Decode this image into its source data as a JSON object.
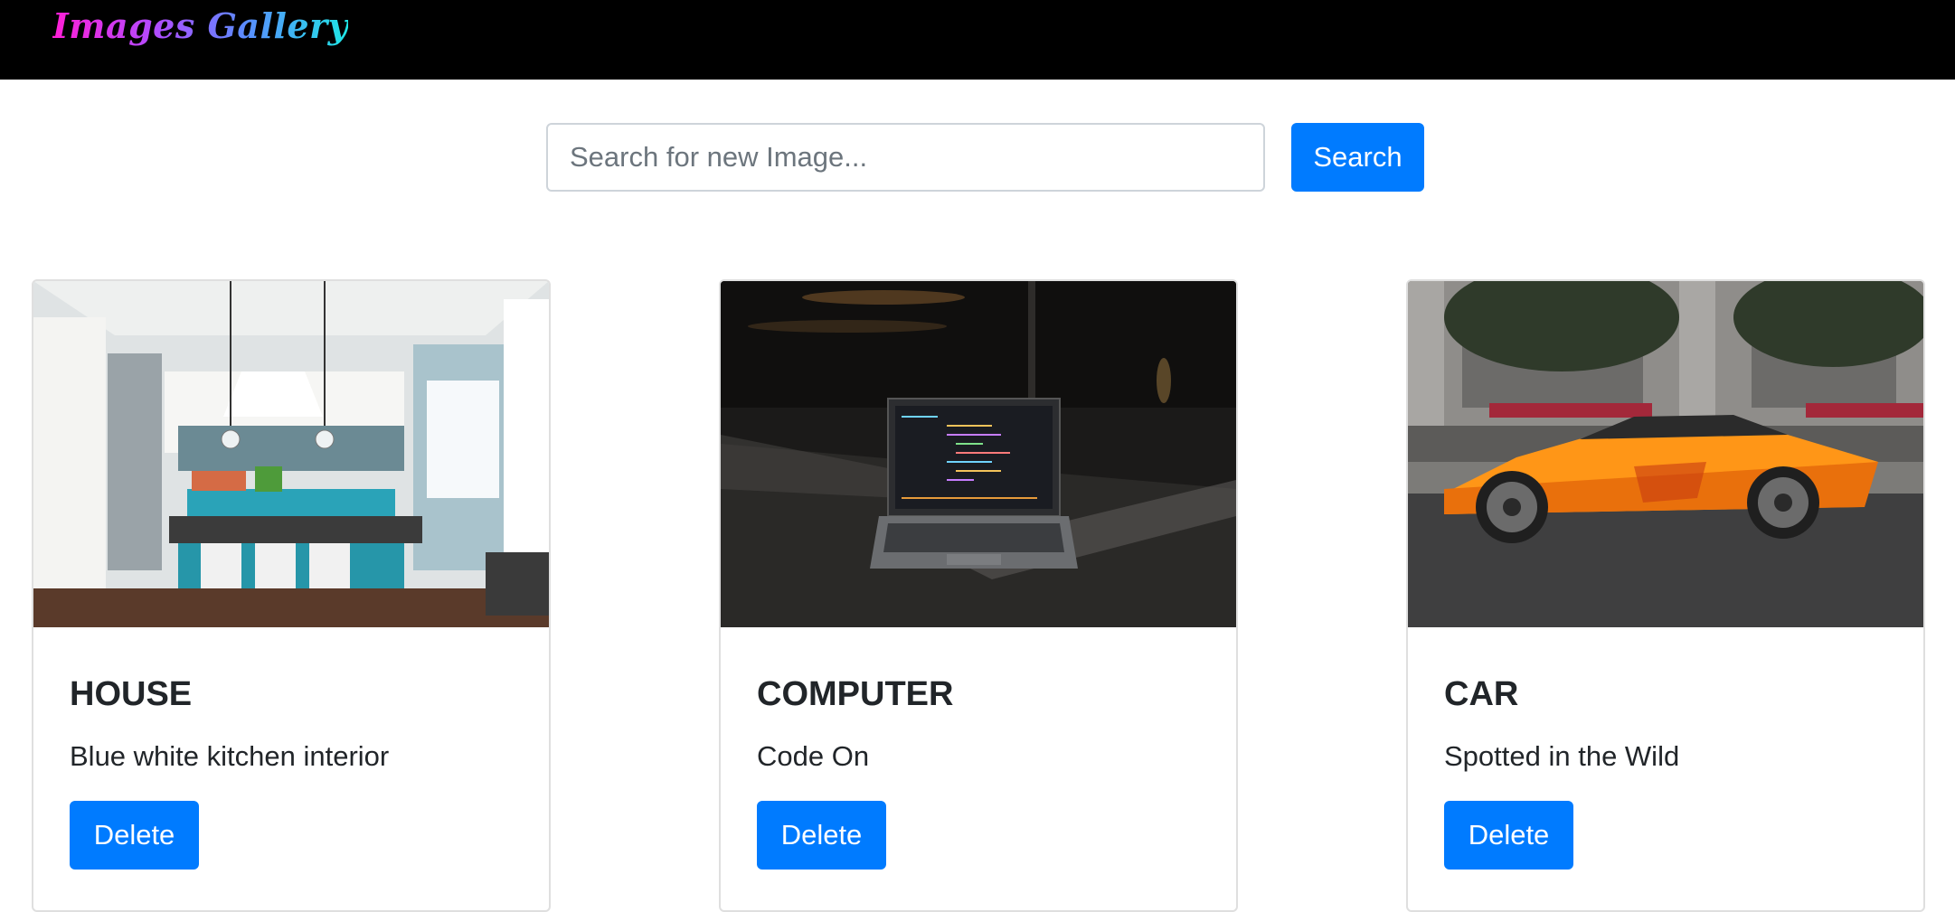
{
  "navbar": {
    "brand": "Images Gallery"
  },
  "search": {
    "placeholder": "Search for new Image...",
    "value": "",
    "button_label": "Search"
  },
  "cards": [
    {
      "title": "HOUSE",
      "description": "Blue white kitchen interior",
      "delete_label": "Delete",
      "image": "kitchen-photo"
    },
    {
      "title": "COMPUTER",
      "description": "Code On",
      "delete_label": "Delete",
      "image": "laptop-photo"
    },
    {
      "title": "CAR",
      "description": "Spotted in the Wild",
      "delete_label": "Delete",
      "image": "car-photo"
    }
  ],
  "colors": {
    "primary": "#007bff",
    "navbar": "#000000"
  }
}
